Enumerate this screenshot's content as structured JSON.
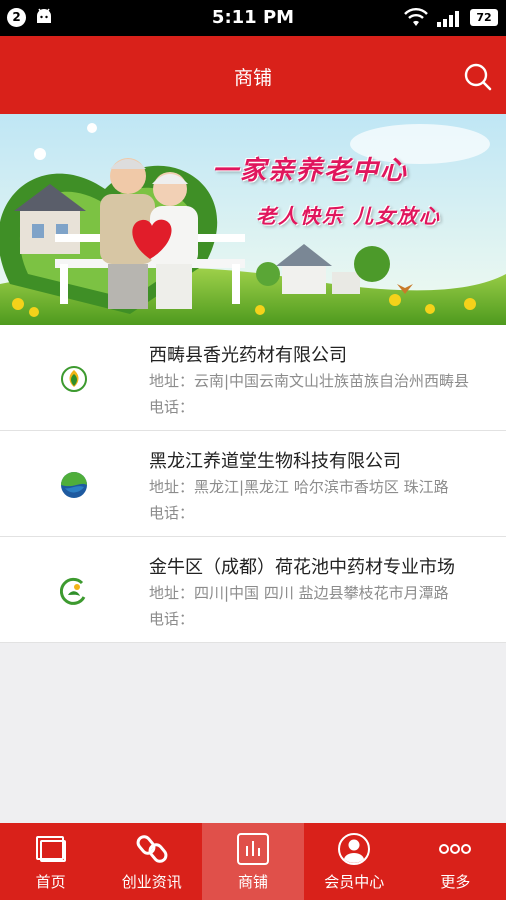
{
  "status_bar": {
    "notification_count": "2",
    "time": "5:11 PM",
    "battery": "72",
    "icons": [
      "android-icon",
      "wifi-icon",
      "signal-icon",
      "battery-icon"
    ]
  },
  "header": {
    "title": "商铺",
    "search_icon": "search-icon",
    "background": "#d9211a"
  },
  "banner": {
    "headline": "一家亲养老中心",
    "subline": "老人快乐 儿女放心"
  },
  "shops": [
    {
      "name": "西畴县香光药材有限公司",
      "address": "地址：云南|中国云南文山壮族苗族自治州西畴县",
      "phone": "电话：",
      "logo": "green-leaf-logo"
    },
    {
      "name": "黑龙江养道堂生物科技有限公司",
      "address": "地址：黑龙江|黑龙江 哈尔滨市香坊区 珠江路",
      "phone": "电话：",
      "logo": "blue-green-swirl-logo"
    },
    {
      "name": "金牛区（成都）荷花池中药材专业市场",
      "address": "地址：四川|中国 四川 盐边县攀枝花市月潭路",
      "phone": "电话：",
      "logo": "green-person-logo"
    }
  ],
  "tabs": [
    {
      "label": "首页",
      "icon": "home-window-icon",
      "active": false
    },
    {
      "label": "创业资讯",
      "icon": "link-icon",
      "active": false
    },
    {
      "label": "商铺",
      "icon": "bar-chart-icon",
      "active": true
    },
    {
      "label": "会员中心",
      "icon": "user-icon",
      "active": false
    },
    {
      "label": "更多",
      "icon": "more-dots-icon",
      "active": false
    }
  ],
  "colors": {
    "brand_red": "#d9211a",
    "active_tab": "#e0504a",
    "list_bg": "#ffffff",
    "page_bg": "#efeff1"
  }
}
